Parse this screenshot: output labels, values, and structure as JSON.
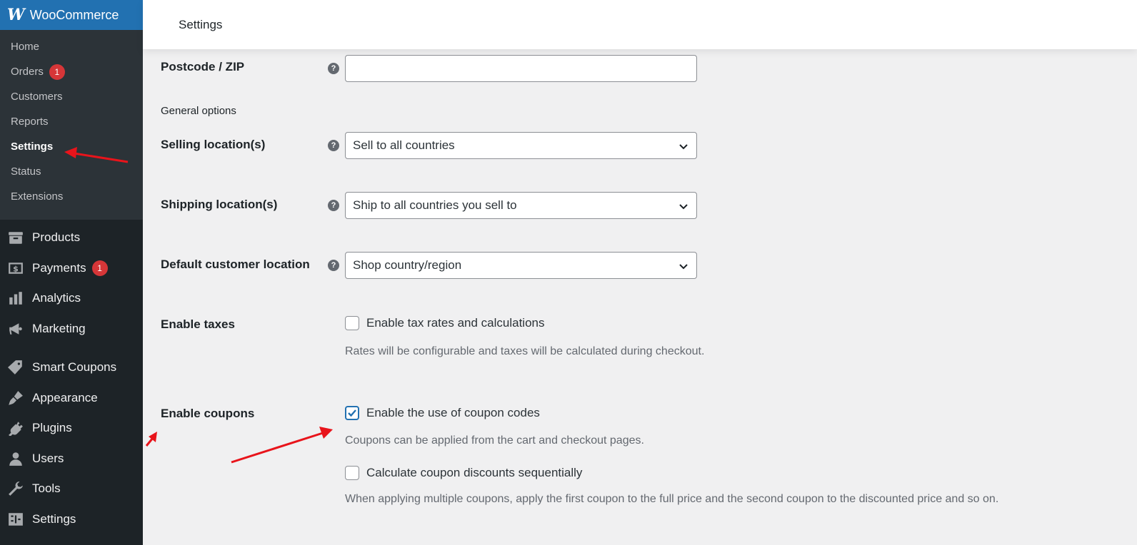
{
  "brand": {
    "logo": "W",
    "name": "WooCommerce"
  },
  "submenu": [
    {
      "label": "Home"
    },
    {
      "label": "Orders",
      "badge": "1"
    },
    {
      "label": "Customers"
    },
    {
      "label": "Reports"
    },
    {
      "label": "Settings",
      "active": true
    },
    {
      "label": "Status"
    },
    {
      "label": "Extensions"
    }
  ],
  "menu": [
    {
      "label": "Products",
      "icon": "archive-icon"
    },
    {
      "label": "Payments",
      "icon": "dollar-icon",
      "badge": "1"
    },
    {
      "label": "Analytics",
      "icon": "bar-chart-icon"
    },
    {
      "label": "Marketing",
      "icon": "megaphone-icon"
    },
    {
      "label": "Smart Coupons",
      "icon": "tag-icon"
    },
    {
      "label": "Appearance",
      "icon": "paintbrush-icon"
    },
    {
      "label": "Plugins",
      "icon": "plug-icon"
    },
    {
      "label": "Users",
      "icon": "user-icon"
    },
    {
      "label": "Tools",
      "icon": "wrench-icon"
    },
    {
      "label": "Settings",
      "icon": "sliders-icon"
    }
  ],
  "header": {
    "title": "Settings"
  },
  "form": {
    "postcode": {
      "label": "Postcode / ZIP",
      "value": ""
    },
    "general_options": "General options",
    "selling": {
      "label": "Selling location(s)",
      "value": "Sell to all countries"
    },
    "shipping": {
      "label": "Shipping location(s)",
      "value": "Ship to all countries you sell to"
    },
    "default_location": {
      "label": "Default customer location",
      "value": "Shop country/region"
    },
    "taxes": {
      "label": "Enable taxes",
      "checkbox_label": "Enable tax rates and calculations",
      "checked": false,
      "description": "Rates will be configurable and taxes will be calculated during checkout."
    },
    "coupons": {
      "label": "Enable coupons",
      "checkbox_label": "Enable the use of coupon codes",
      "checked": true,
      "description": "Coupons can be applied from the cart and checkout pages.",
      "sequential_label": "Calculate coupon discounts sequentially",
      "sequential_checked": false,
      "sequential_description": "When applying multiple coupons, apply the first coupon to the full price and the second coupon to the discounted price and so on."
    }
  },
  "help_glyph": "?",
  "colors": {
    "sidebar": "#1d2327",
    "accent": "#2271b1",
    "badge": "#d63638",
    "annotation": "#e8141b"
  }
}
